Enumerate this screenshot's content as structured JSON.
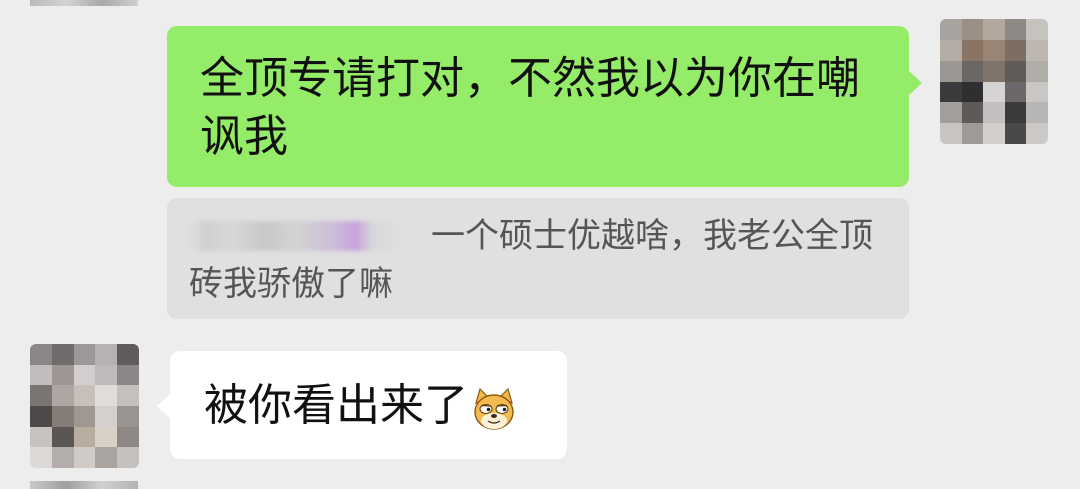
{
  "messages": {
    "outgoing": {
      "text": "全顶专请打对，不然我以为你在嘲讽我"
    },
    "quote": {
      "text": "一个硕士优越啥，我老公全顶砖我骄傲了嘛"
    },
    "incoming": {
      "text": "被你看出来了",
      "emoji": "doge-emoji"
    }
  },
  "colors": {
    "background": "#ededed",
    "outgoing_bubble": "#95ec69",
    "incoming_bubble": "#ffffff",
    "quote_box": "#e0e0e0",
    "quote_text": "#555555"
  },
  "avatars": {
    "self": "pixelated-avatar",
    "other": "pixelated-avatar"
  }
}
